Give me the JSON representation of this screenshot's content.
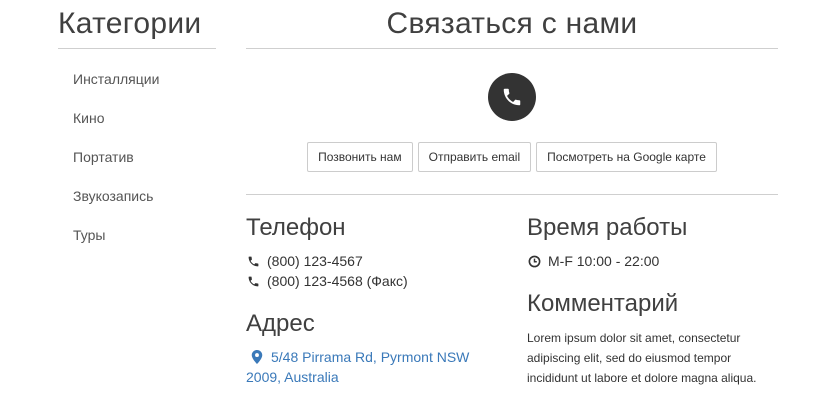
{
  "sidebar": {
    "title": "Категории",
    "items": [
      {
        "label": "Инсталляции"
      },
      {
        "label": "Кино"
      },
      {
        "label": "Портатив"
      },
      {
        "label": "Звукозапись"
      },
      {
        "label": "Туры"
      }
    ]
  },
  "main": {
    "title": "Связаться с нами",
    "hero_icon": "phone-icon",
    "buttons": {
      "call": "Позвонить нам",
      "email": "Отправить email",
      "map": "Посмотреть на Google карте"
    },
    "phone": {
      "title": "Телефон",
      "lines": [
        "(800) 123-4567",
        "(800) 123-4568 (Факс)"
      ]
    },
    "address": {
      "title": "Адрес",
      "text": "5/48 Pirrama Rd, Pyrmont NSW 2009, Australia"
    },
    "hours": {
      "title": "Время работы",
      "text": "M-F 10:00 - 22:00"
    },
    "comment": {
      "title": "Комментарий",
      "text": "Lorem ipsum dolor sit amet, consectetur adipiscing elit, sed do eiusmod tempor incididunt ut labore et dolore magna aliqua."
    }
  },
  "colors": {
    "text": "#333333",
    "heading": "#404040",
    "link": "#3a79b9",
    "divider": "#cfcfcf",
    "icon_circle": "#333333"
  }
}
